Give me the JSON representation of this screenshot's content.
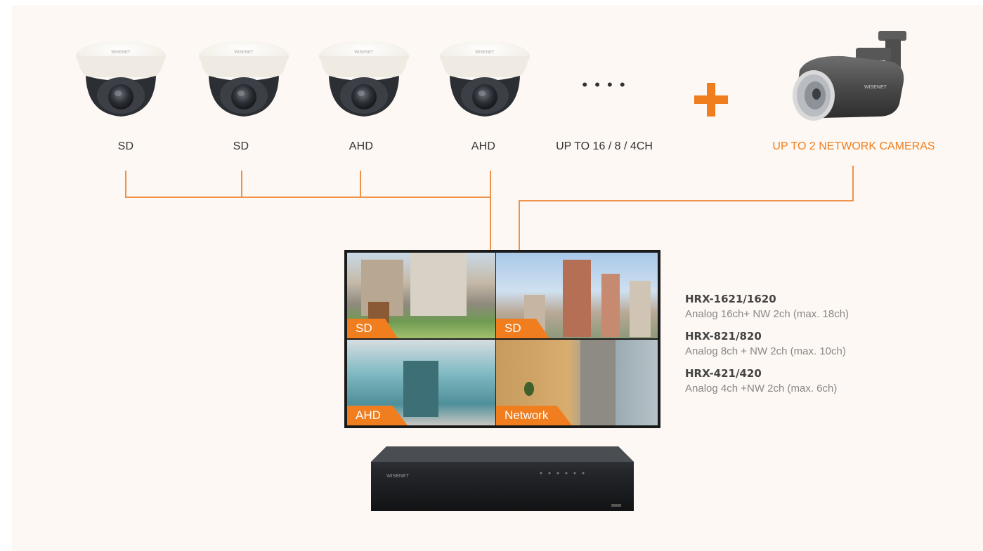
{
  "colors": {
    "accent": "#f07e1e",
    "line": "#f0914a",
    "background": "#fdf8f3"
  },
  "dome_cameras": [
    {
      "label": "SD",
      "brand": "WISENET"
    },
    {
      "label": "SD",
      "brand": "WISENET"
    },
    {
      "label": "AHD",
      "brand": "WISENET"
    },
    {
      "label": "AHD",
      "brand": "WISENET"
    }
  ],
  "ellipsis": "• • • •",
  "channel_label": "UP TO 16 / 8 / 4CH",
  "plus_sign": "+",
  "network_camera": {
    "label": "UP TO 2 NETWORK CAMERAS",
    "brand": "WISENET"
  },
  "monitor_panels": [
    {
      "tag": "SD",
      "scene": "residential-buildings"
    },
    {
      "tag": "SD",
      "scene": "city-skyline"
    },
    {
      "tag": "AHD",
      "scene": "glass-entrance"
    },
    {
      "tag": "Network",
      "scene": "elevator-lobby"
    }
  ],
  "recorder": {
    "brand": "WISENET"
  },
  "models": [
    {
      "name": "HRX-1621/1620",
      "desc": "Analog 16ch+ NW 2ch (max. 18ch)"
    },
    {
      "name": "HRX-821/820",
      "desc": "Analog 8ch + NW 2ch (max. 10ch)"
    },
    {
      "name": "HRX-421/420",
      "desc": "Analog 4ch +NW 2ch (max. 6ch)"
    }
  ]
}
